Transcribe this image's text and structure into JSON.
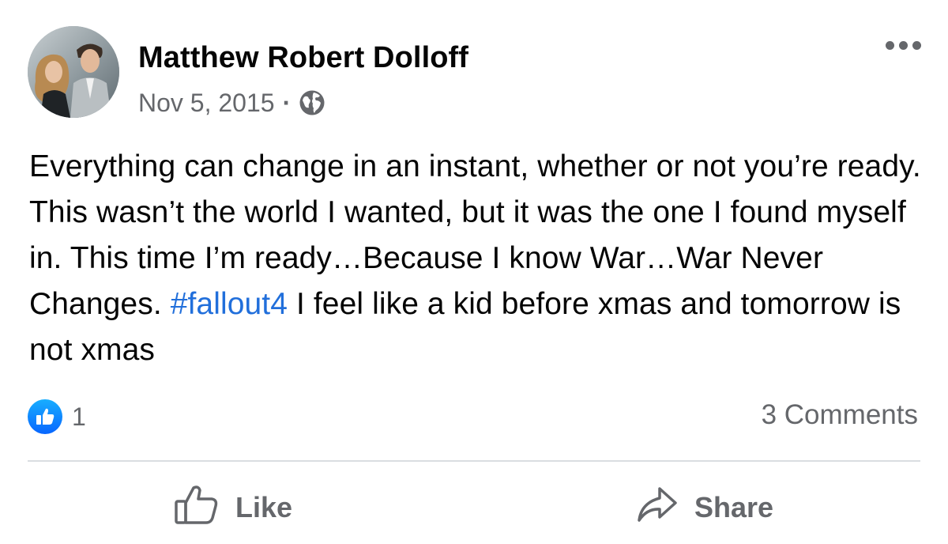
{
  "post": {
    "author": "Matthew Robert Dolloff",
    "date": "Nov 5, 2015",
    "separator": "·",
    "privacy_icon": "globe-icon",
    "more_icon": "more-options-icon",
    "text_before_hashtag": "Everything can change in an instant, whether or not you’re ready. This wasn’t the world I wanted, but it was the one I found myself in. This time I’m ready…Because I know War…War Never Changes. ",
    "hashtag": "#fallout4",
    "text_after_hashtag": " I feel like a kid before xmas and tomorrow is not xmas"
  },
  "stats": {
    "reaction_icon": "like-reaction-icon",
    "reaction_count": "1",
    "comments": "3 Comments"
  },
  "actions": {
    "like_label": "Like",
    "share_label": "Share"
  },
  "colors": {
    "hashtag": "#216fdb",
    "secondary_text": "#65676b",
    "like_blue": "#0866ff",
    "divider": "#dadde1"
  }
}
